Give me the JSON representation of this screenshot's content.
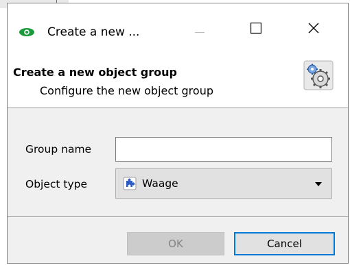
{
  "window": {
    "title": "Create a new ...",
    "controls": {
      "minimize": "minimize",
      "maximize": "maximize",
      "close": "close"
    }
  },
  "header": {
    "title": "Create a new object group",
    "subtitle": "Configure the new object group",
    "icon": "gear-settings-icon"
  },
  "form": {
    "group_name_label": "Group name",
    "group_name_value": "",
    "object_type_label": "Object type",
    "object_type_selected": "Waage",
    "object_type_icon": "blue-puzzle-icon"
  },
  "buttons": {
    "ok_label": "OK",
    "ok_enabled": false,
    "cancel_label": "Cancel"
  },
  "colors": {
    "app_icon": "#1a9a3a",
    "focus_border": "#0078d7",
    "disabled_text": "#838383"
  }
}
